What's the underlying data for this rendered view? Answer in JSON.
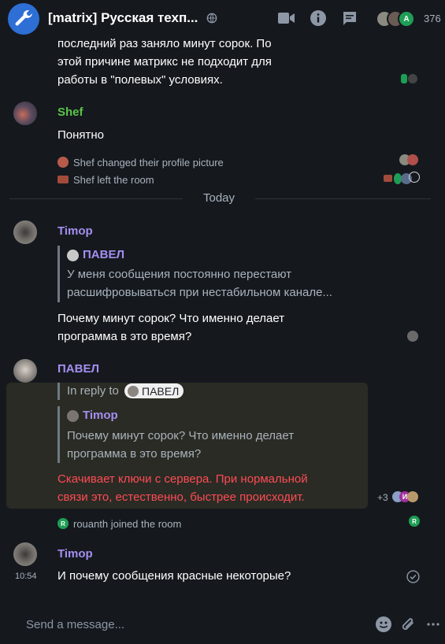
{
  "header": {
    "room_name": "[matrix] Русская техп...",
    "member_count": "376",
    "member_avatar_initial": "A"
  },
  "timeline": {
    "top_message": {
      "lines": [
        "последний раз заняло минут сорок. По",
        "этой причине матрикс не подходит для",
        "работы в \"полевых\" условиях."
      ]
    },
    "shef_message": {
      "sender": "Shef",
      "body": "Понятно"
    },
    "shef_events": [
      "Shef changed their profile picture",
      "Shef left the room"
    ],
    "date_separator": "Today",
    "timop_message_1": {
      "sender": "Timop",
      "quote_sender": "ПАВЕЛ",
      "quote_lines": [
        "У меня сообщения постоянно перестают",
        "расшифровываться при нестабильном канале..."
      ],
      "body_lines": [
        "Почему минут сорок? Что именно делает",
        "программа в это время?"
      ]
    },
    "pavel_message": {
      "sender": "ПАВЕЛ",
      "in_reply_to_label": "In reply to",
      "in_reply_to_user": "ПАВЕЛ",
      "quote_sender": "Timop",
      "quote_lines": [
        "Почему минут сорок? Что именно делает",
        "программа в это время?"
      ],
      "body_lines": [
        "Скачивает ключи с сервера. При нормальной",
        "связи это, естественно, быстрее происходит."
      ],
      "read_receipts_more": "+3",
      "receipt_initial": "И"
    },
    "join_event": {
      "text": "rouanth joined the room",
      "avatar_initial": "R"
    },
    "timop_message_2": {
      "sender": "Timop",
      "timestamp": "10:54",
      "body": "И почему сообщения красные некоторые?"
    }
  },
  "composer": {
    "placeholder": "Send a message..."
  },
  "colors": {
    "background": "#15191e",
    "timop": "#a58ef0",
    "shef": "#5bc44a",
    "pavel": "#a58ef0",
    "error_text": "#ff4b55",
    "highlight": "#2a2b24"
  }
}
